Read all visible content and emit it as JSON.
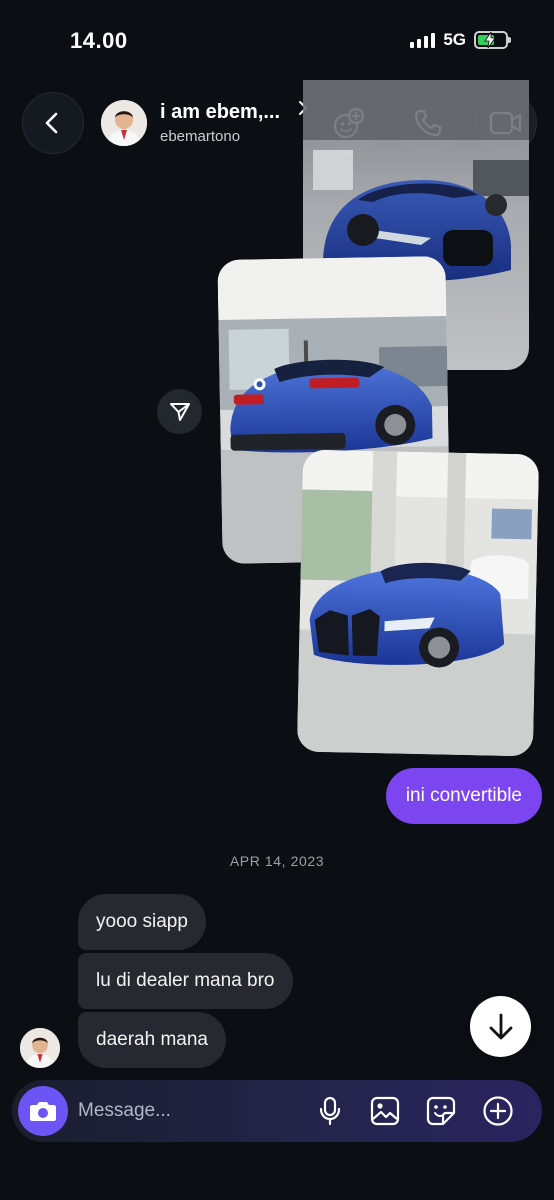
{
  "status_bar": {
    "time": "14.00",
    "network": "5G",
    "battery_level": 0.55,
    "battery_color": "#33d058"
  },
  "header": {
    "title": "i am ebem,...",
    "username": "ebemartono",
    "icons": {
      "back": "chevron-left-icon",
      "more": "chevron-right-icon",
      "add_people": "add-friends-icon",
      "call": "phone-icon",
      "video": "video-camera-icon"
    }
  },
  "messages": {
    "photos": [
      "blue-convertible-front-view",
      "blue-convertible-rear-view",
      "blue-convertible-showroom-view"
    ],
    "share_icon": "send-arrow-icon",
    "sent_text": "ini convertible",
    "date_separator": "APR 14, 2023",
    "received": [
      {
        "text": "yooo siapp"
      },
      {
        "text": "lu di dealer mana bro"
      },
      {
        "text": "daerah mana"
      }
    ],
    "scroll_icon": "arrow-down-icon"
  },
  "composer": {
    "placeholder": "Message...",
    "icons": [
      "camera-icon",
      "microphone-icon",
      "gallery-icon",
      "sticker-icon",
      "plus-circle-icon"
    ]
  },
  "colors": {
    "background": "#0b0f14",
    "sent_bubble": "#7b45f0",
    "received_bubble": "#262a30",
    "camera_button": "#6d54f5"
  }
}
